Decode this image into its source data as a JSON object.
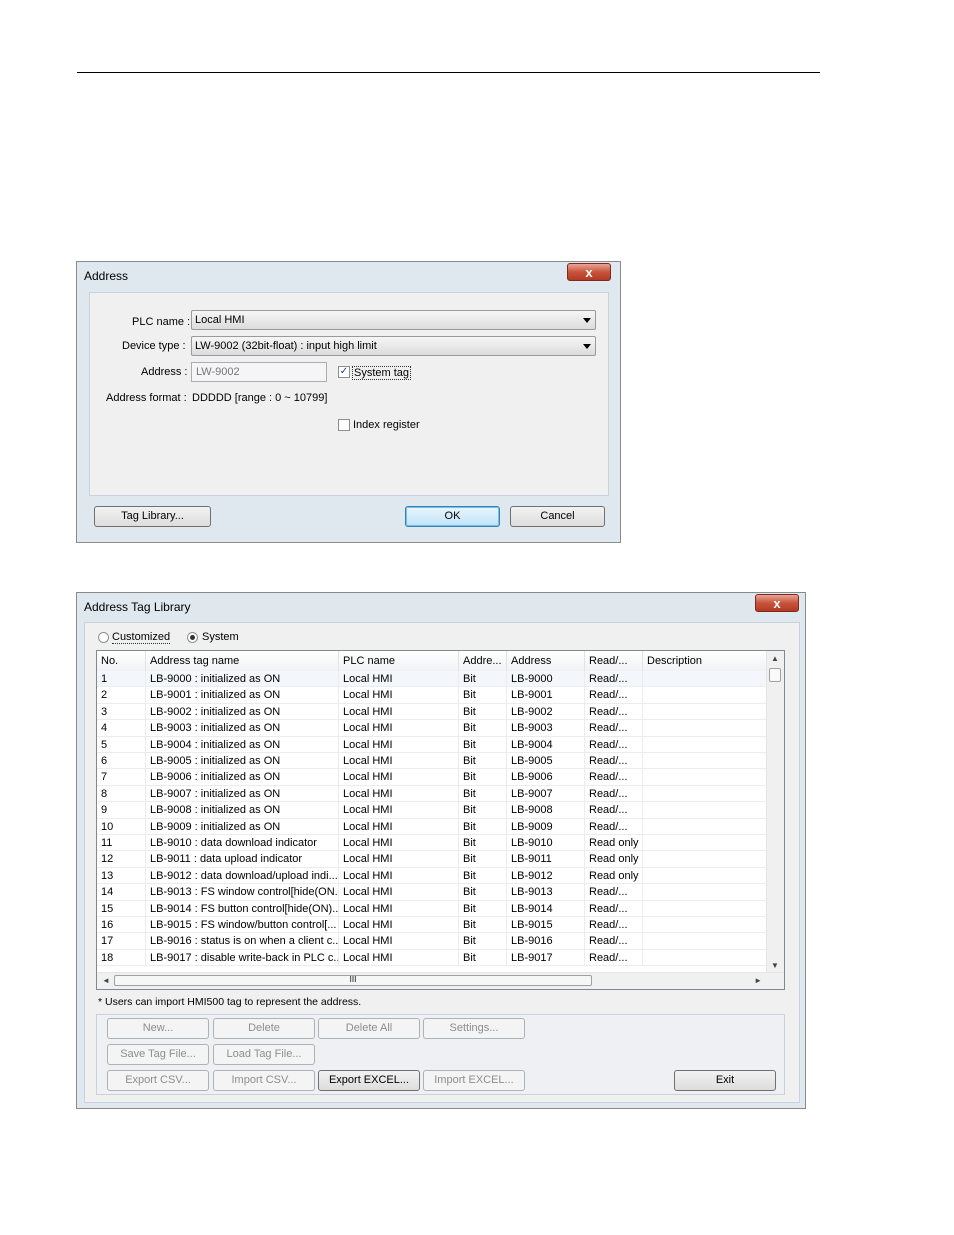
{
  "address_dialog": {
    "title": "Address",
    "close": "x",
    "plc_name_label": "PLC name :",
    "plc_name_value": "Local HMI",
    "device_type_label": "Device type :",
    "device_type_value": "LW-9002 (32bit-float) : input high limit",
    "address_label": "Address :",
    "address_value": "LW-9002",
    "system_tag_label": "System tag",
    "system_tag_checked": true,
    "address_format_label": "Address format :",
    "address_format_value": "DDDDD [range : 0 ~ 10799]",
    "index_register_label": "Index register",
    "index_register_checked": false,
    "tag_library_button": "Tag Library...",
    "ok_button": "OK",
    "cancel_button": "Cancel"
  },
  "tag_library_dialog": {
    "title": "Address Tag Library",
    "close": "x",
    "radio_customized": "Customized",
    "radio_system": "System",
    "selected_radio": "System",
    "columns": [
      "No.",
      "Address tag name",
      "PLC name",
      "Addre...",
      "Address",
      "Read/...",
      "Description"
    ],
    "rows": [
      [
        "1",
        "LB-9000 : initialized as ON",
        "Local HMI",
        "Bit",
        "LB-9000",
        "Read/...",
        ""
      ],
      [
        "2",
        "LB-9001 : initialized as ON",
        "Local HMI",
        "Bit",
        "LB-9001",
        "Read/...",
        ""
      ],
      [
        "3",
        "LB-9002 : initialized as ON",
        "Local HMI",
        "Bit",
        "LB-9002",
        "Read/...",
        ""
      ],
      [
        "4",
        "LB-9003 : initialized as ON",
        "Local HMI",
        "Bit",
        "LB-9003",
        "Read/...",
        ""
      ],
      [
        "5",
        "LB-9004 : initialized as ON",
        "Local HMI",
        "Bit",
        "LB-9004",
        "Read/...",
        ""
      ],
      [
        "6",
        "LB-9005 : initialized as ON",
        "Local HMI",
        "Bit",
        "LB-9005",
        "Read/...",
        ""
      ],
      [
        "7",
        "LB-9006 : initialized as ON",
        "Local HMI",
        "Bit",
        "LB-9006",
        "Read/...",
        ""
      ],
      [
        "8",
        "LB-9007 : initialized as ON",
        "Local HMI",
        "Bit",
        "LB-9007",
        "Read/...",
        ""
      ],
      [
        "9",
        "LB-9008 : initialized as ON",
        "Local HMI",
        "Bit",
        "LB-9008",
        "Read/...",
        ""
      ],
      [
        "10",
        "LB-9009 : initialized as ON",
        "Local HMI",
        "Bit",
        "LB-9009",
        "Read/...",
        ""
      ],
      [
        "11",
        "LB-9010 : data download indicator",
        "Local HMI",
        "Bit",
        "LB-9010",
        "Read only",
        ""
      ],
      [
        "12",
        "LB-9011 : data upload indicator",
        "Local HMI",
        "Bit",
        "LB-9011",
        "Read only",
        ""
      ],
      [
        "13",
        "LB-9012 : data download/upload indi...",
        "Local HMI",
        "Bit",
        "LB-9012",
        "Read only",
        ""
      ],
      [
        "14",
        "LB-9013 : FS window control[hide(ON...",
        "Local HMI",
        "Bit",
        "LB-9013",
        "Read/...",
        ""
      ],
      [
        "15",
        "LB-9014 : FS button control[hide(ON)...",
        "Local HMI",
        "Bit",
        "LB-9014",
        "Read/...",
        ""
      ],
      [
        "16",
        "LB-9015 : FS window/button control[...",
        "Local HMI",
        "Bit",
        "LB-9015",
        "Read/...",
        ""
      ],
      [
        "17",
        "LB-9016 : status is on when a client c...",
        "Local HMI",
        "Bit",
        "LB-9016",
        "Read/...",
        ""
      ],
      [
        "18",
        "LB-9017 : disable write-back in PLC c...",
        "Local HMI",
        "Bit",
        "LB-9017",
        "Read/...",
        ""
      ]
    ],
    "hscroll_grip": "III",
    "note": "* Users can import HMI500 tag to represent the address.",
    "buttons": {
      "new": "New...",
      "delete": "Delete",
      "delete_all": "Delete All",
      "settings": "Settings...",
      "save_tag_file": "Save Tag File...",
      "load_tag_file": "Load Tag File...",
      "export_csv": "Export CSV...",
      "import_csv": "Import CSV...",
      "export_excel": "Export EXCEL...",
      "import_excel": "Import EXCEL...",
      "exit": "Exit"
    }
  }
}
